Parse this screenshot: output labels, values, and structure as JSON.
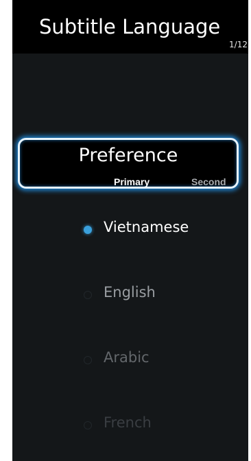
{
  "header": {
    "title": "Subtitle Language",
    "page_indicator": "1/12"
  },
  "preference": {
    "title": "Preference",
    "primary_label": "Primary",
    "secondary_label": "Second"
  },
  "options": [
    {
      "label": "Vietnamese",
      "selected": true,
      "color": "#ffffff"
    },
    {
      "label": "English",
      "selected": false,
      "color": "#9a9ea2"
    },
    {
      "label": "Arabic",
      "selected": false,
      "color": "#63676b"
    },
    {
      "label": "French",
      "selected": false,
      "color": "#3a3e42"
    }
  ],
  "colors": {
    "accent": "#3aa0dc",
    "glow": "#1f7fc8"
  }
}
